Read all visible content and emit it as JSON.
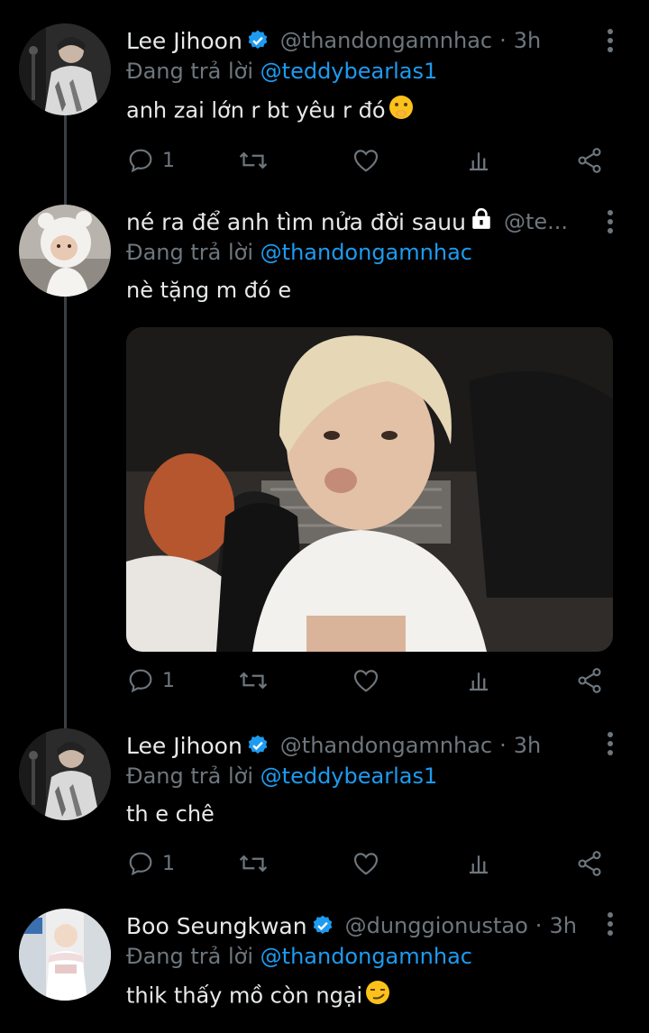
{
  "tweets": [
    {
      "name": "Lee Jihoon",
      "verified": true,
      "handle": "@thandongamnhac",
      "dot": "·",
      "time": "3h",
      "reply_prefix": "Đang trả lời",
      "reply_to": "@teddybearlas1",
      "text": "anh zai lớn r bt yêu r đó",
      "text_emoji": "shushing-face-emoji",
      "reply_count": "1"
    },
    {
      "name": "né ra để anh tìm nửa đời sauu",
      "name_icon": "lock-icon",
      "verified": false,
      "handle": "@te...",
      "reply_prefix": "Đang trả lời",
      "reply_to": "@thandongamnhac",
      "text": "nè tặng m đó e",
      "has_media": true,
      "reply_count": "1"
    },
    {
      "name": "Lee Jihoon",
      "verified": true,
      "handle": "@thandongamnhac",
      "dot": "·",
      "time": "3h",
      "reply_prefix": "Đang trả lời",
      "reply_to": "@teddybearlas1",
      "text": "th e chê",
      "reply_count": "1"
    },
    {
      "name": "Boo Seungkwan",
      "verified": true,
      "handle": "@dunggionustao",
      "dot": "·",
      "time": "3h",
      "reply_prefix": "Đang trả lời",
      "reply_to": "@thandongamnhac",
      "text": "thik thấy mồ còn ngại",
      "text_emoji": "smirking-face-emoji"
    }
  ],
  "colors": {
    "background": "#000000",
    "text": "#e7e9ea",
    "muted": "#6e767d",
    "accent": "#1d9bf0",
    "thread_line": "#3a3f44"
  },
  "icons": [
    "reply-icon",
    "retweet-icon",
    "like-icon",
    "analytics-icon",
    "share-icon",
    "more-icon",
    "verified-icon"
  ]
}
